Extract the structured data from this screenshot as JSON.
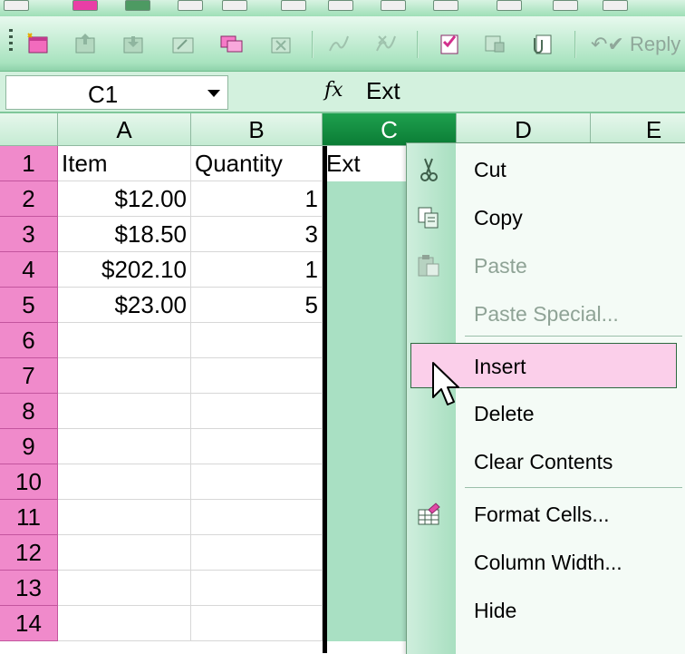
{
  "formula_bar": {
    "name_box": "C1",
    "fx_label": "fx",
    "formula": "Ext"
  },
  "toolbar": {
    "reply_label": "Reply"
  },
  "columns": [
    "A",
    "B",
    "C",
    "D",
    "E"
  ],
  "rows": [
    {
      "num": "1",
      "a": "Item",
      "b": "Quantity",
      "c": "Ext"
    },
    {
      "num": "2",
      "a": "$12.00",
      "b": "1",
      "c": ""
    },
    {
      "num": "3",
      "a": "$18.50",
      "b": "3",
      "c": ""
    },
    {
      "num": "4",
      "a": "$202.10",
      "b": "1",
      "c": ""
    },
    {
      "num": "5",
      "a": "$23.00",
      "b": "5",
      "c": ""
    },
    {
      "num": "6"
    },
    {
      "num": "7"
    },
    {
      "num": "8"
    },
    {
      "num": "9"
    },
    {
      "num": "10"
    },
    {
      "num": "11"
    },
    {
      "num": "12"
    },
    {
      "num": "13"
    },
    {
      "num": "14"
    }
  ],
  "context_menu": {
    "items": [
      {
        "label": "Cut",
        "icon": "scissors-icon",
        "enabled": true
      },
      {
        "label": "Copy",
        "icon": "copy-icon",
        "enabled": true
      },
      {
        "label": "Paste",
        "icon": "paste-icon",
        "enabled": false
      },
      {
        "label": "Paste Special...",
        "enabled": false
      },
      {
        "label": "Insert",
        "enabled": true,
        "highlighted": true
      },
      {
        "label": "Delete",
        "enabled": true
      },
      {
        "label": "Clear Contents",
        "enabled": true
      },
      {
        "label": "Format Cells...",
        "icon": "format-cells-icon",
        "enabled": true
      },
      {
        "label": "Column Width...",
        "enabled": true
      },
      {
        "label": "Hide",
        "enabled": true
      }
    ]
  },
  "colors": {
    "selected_column_header": "#0b7d35",
    "selected_column_fill": "#a9e0c3",
    "row_header": "#f08acb",
    "menu_highlight": "#fbcfea"
  }
}
